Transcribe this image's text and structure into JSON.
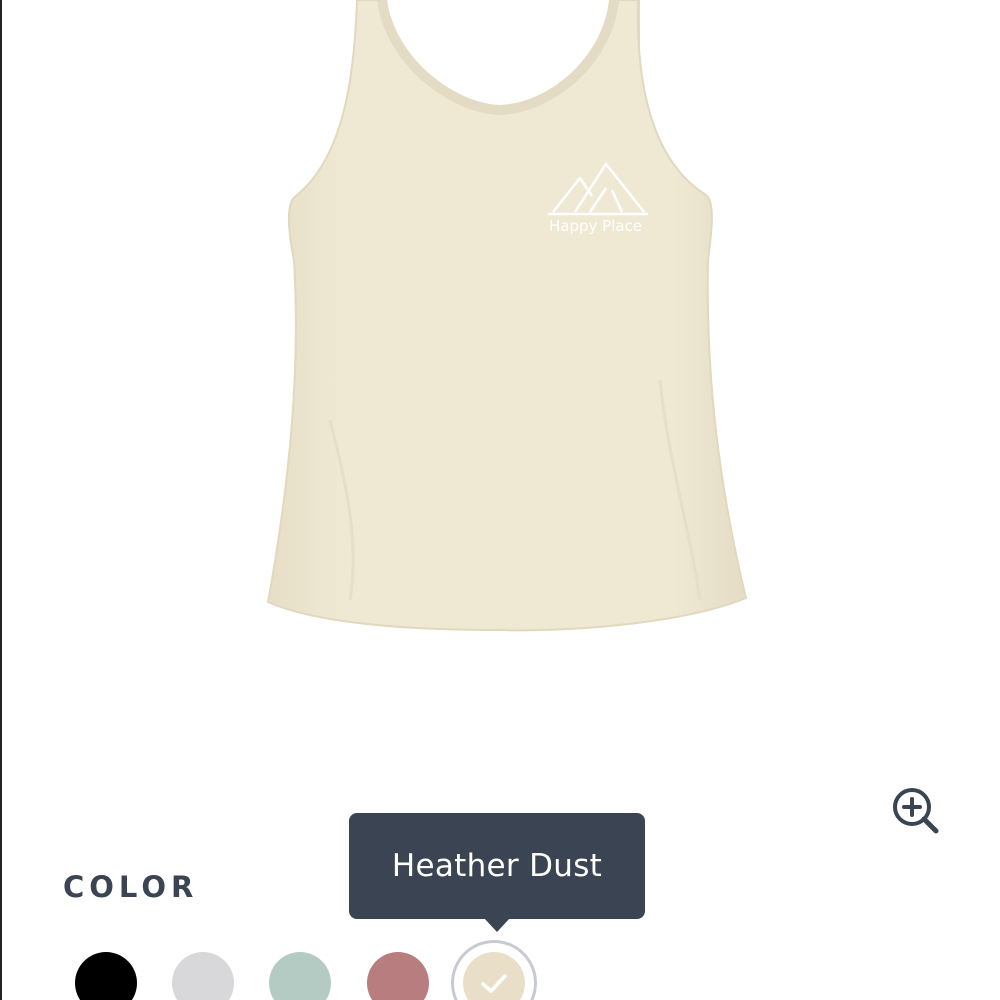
{
  "product": {
    "image_name": "slouchy tank top",
    "print_text": "Happy Place",
    "garment_color": "#efe8d3",
    "print_color": "#ffffff"
  },
  "zoom": {
    "icon": "zoom-in-icon"
  },
  "color_picker": {
    "heading": "COLOR",
    "tooltip": "Heather Dust",
    "selected_index": 4,
    "swatches": [
      {
        "color": "#000000"
      },
      {
        "color": "#d8d8da"
      },
      {
        "color": "#b3cbc3"
      },
      {
        "color": "#b77d7f"
      },
      {
        "color": "#e9dfc8",
        "name": "Heather Dust"
      }
    ]
  },
  "colors": {
    "tooltip_bg": "#3b4452",
    "heading": "#3b4452",
    "selected_ring": "#c7cbd1"
  }
}
